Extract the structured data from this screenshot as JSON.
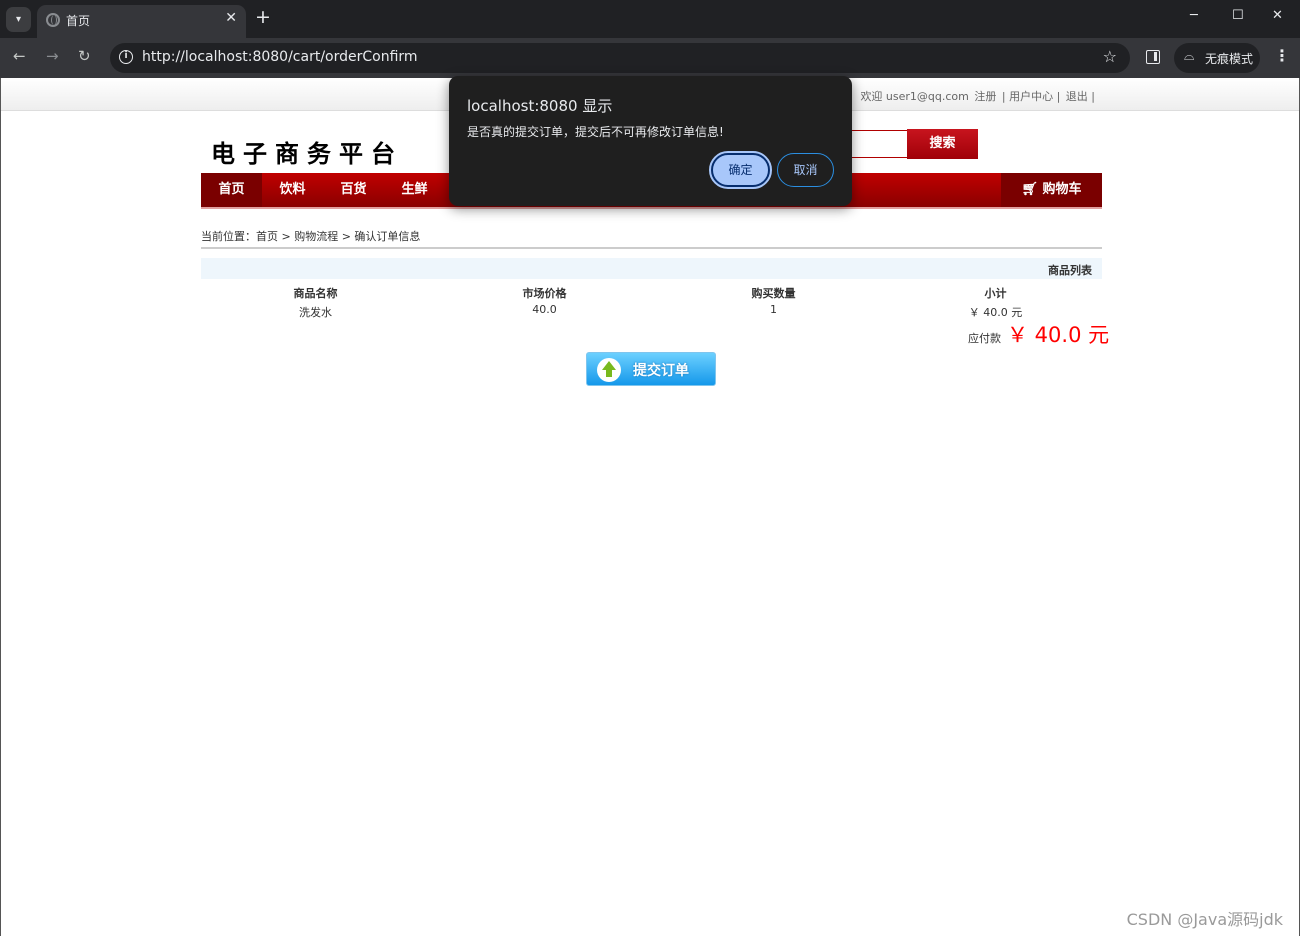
{
  "browser": {
    "tab_title": "首页",
    "url": "http://localhost:8080/cart/orderConfirm",
    "incognito_label": "无痕模式"
  },
  "topbar": {
    "welcome": "欢迎 user1@qq.com",
    "register": "注册",
    "user_center": "| 用户中心 |",
    "logout": "退出 |"
  },
  "header": {
    "logo": "电子商务平台",
    "search_button": "搜索"
  },
  "nav": {
    "items": [
      "首页",
      "饮料",
      "百货",
      "生鲜"
    ],
    "cart": "购物车"
  },
  "breadcrumb": "当前位置：首页 > 购物流程 > 确认订单信息",
  "product_list": {
    "title": "商品列表",
    "columns": [
      "商品名称",
      "市场价格",
      "购买数量",
      "小计"
    ],
    "rows": [
      [
        "洗发水",
        "40.0",
        "1",
        "￥ 40.0 元"
      ]
    ]
  },
  "total": {
    "label": "应付款",
    "value": "￥ 40.0 元"
  },
  "submit_button": "提交订单",
  "dialog": {
    "title": "localhost:8080 显示",
    "message": "是否真的提交订单，提交后不可再修改订单信息!",
    "ok": "确定",
    "cancel": "取消"
  },
  "watermark": "CSDN @Java源码jdk",
  "colors": {
    "brand_red": "#b00000",
    "price_red": "#ff0000",
    "dialog_bg": "#1f1f1f",
    "dialog_ok": "#a8c7fa"
  },
  "icons": [
    "tab-menu-icon",
    "globe-icon",
    "close-icon",
    "plus-icon",
    "back-icon",
    "forward-icon",
    "reload-icon",
    "info-icon",
    "star-icon",
    "side-panel-icon",
    "incognito-icon",
    "more-icon",
    "cart-icon",
    "up-arrow-icon"
  ]
}
